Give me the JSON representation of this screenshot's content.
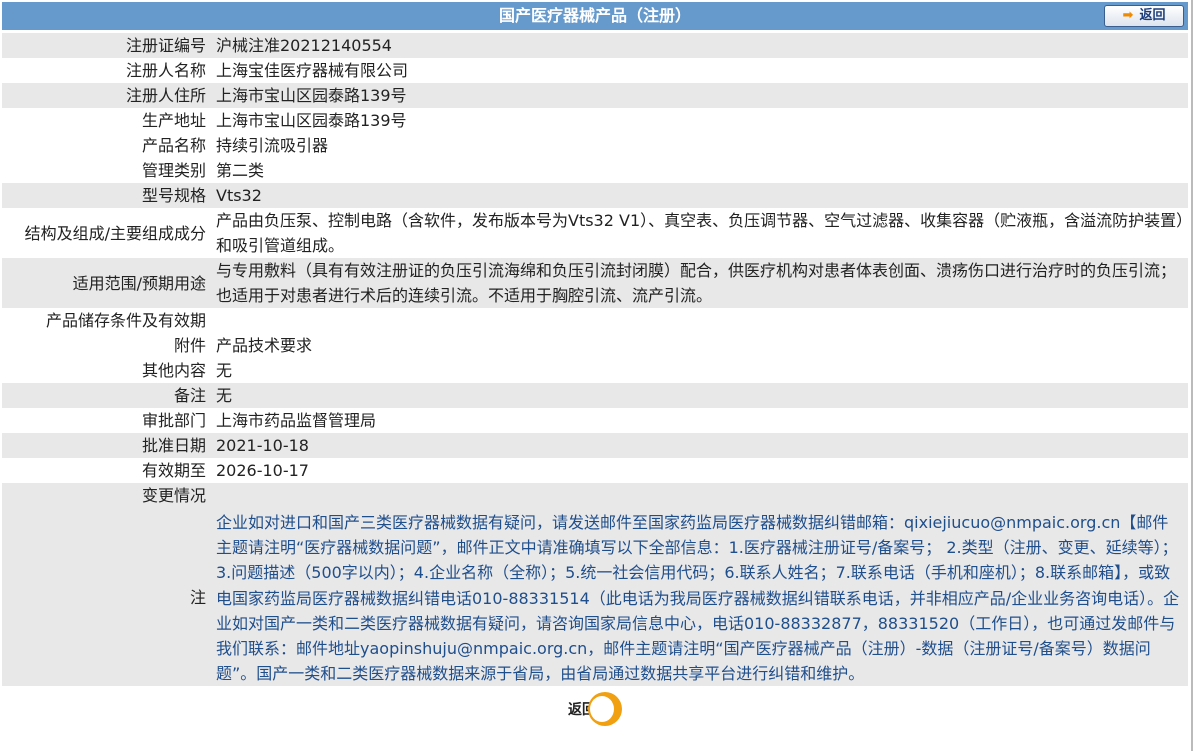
{
  "header": {
    "title": "国产医疗器械产品（注册）",
    "back_label": "返回"
  },
  "rows": [
    {
      "label": "注册证编号",
      "value": "沪械注准20212140554"
    },
    {
      "label": "注册人名称",
      "value": "上海宝佳医疗器械有限公司"
    },
    {
      "label": "注册人住所",
      "value": "上海市宝山区园泰路139号"
    },
    {
      "label": "生产地址",
      "value": "上海市宝山区园泰路139号"
    },
    {
      "label": "产品名称",
      "value": "持续引流吸引器"
    },
    {
      "label": "管理类别",
      "value": "第二类"
    },
    {
      "label": "型号规格",
      "value": "Vts32"
    },
    {
      "label": "结构及组成/主要组成成分",
      "value": "产品由负压泵、控制电路（含软件，发布版本号为Vts32 V1）、真空表、负压调节器、空气过滤器、收集容器（贮液瓶，含溢流防护装置）和吸引管道组成。"
    },
    {
      "label": "适用范围/预期用途",
      "value": "与专用敷料（具有有效注册证的负压引流海绵和负压引流封闭膜）配合，供医疗机构对患者体表创面、溃疡伤口进行治疗时的负压引流；也适用于对患者进行术后的连续引流。不适用于胸腔引流、流产引流。"
    },
    {
      "label": "产品储存条件及有效期",
      "value": ""
    },
    {
      "label": "附件",
      "value": "产品技术要求"
    },
    {
      "label": "其他内容",
      "value": "无"
    },
    {
      "label": "备注",
      "value": "无"
    },
    {
      "label": "审批部门",
      "value": "上海市药品监督管理局"
    },
    {
      "label": "批准日期",
      "value": "2021-10-18"
    },
    {
      "label": "有效期至",
      "value": "2026-10-17"
    },
    {
      "label": "变更情况",
      "value": ""
    }
  ],
  "note": {
    "label": "注",
    "text": "企业如对进口和国产三类医疗器械数据有疑问，请发送邮件至国家药监局医疗器械数据纠错邮箱：qixiejiucuo@nmpaic.org.cn【邮件主题请注明“医疗器械数据问题”，邮件正文中请准确填写以下全部信息：1.医疗器械注册证号/备案号； 2.类型（注册、变更、延续等）；3.问题描述（500字以内）；4.企业名称（全称）；5.统一社会信用代码；6.联系人姓名；7.联系电话（手机和座机）；8.联系邮箱】，或致电国家药监局医疗器械数据纠错电话010-88331514（此电话为我局医疗器械数据纠错联系电话，并非相应产品/企业业务咨询电话）。企业如对国产一类和二类医疗器械数据有疑问，请咨询国家局信息中心，电话010-88332877，88331520（工作日），也可通过发邮件与我们联系：邮件地址yaopinshuju@nmpaic.org.cn，邮件主题请注明“国产医疗器械产品（注册）-数据（注册证号/备案号）数据问题”。国产一类和二类医疗器械数据来源于省局，由省局通过数据共享平台进行纠错和维护。"
  },
  "footer": {
    "back_label": "返回"
  }
}
